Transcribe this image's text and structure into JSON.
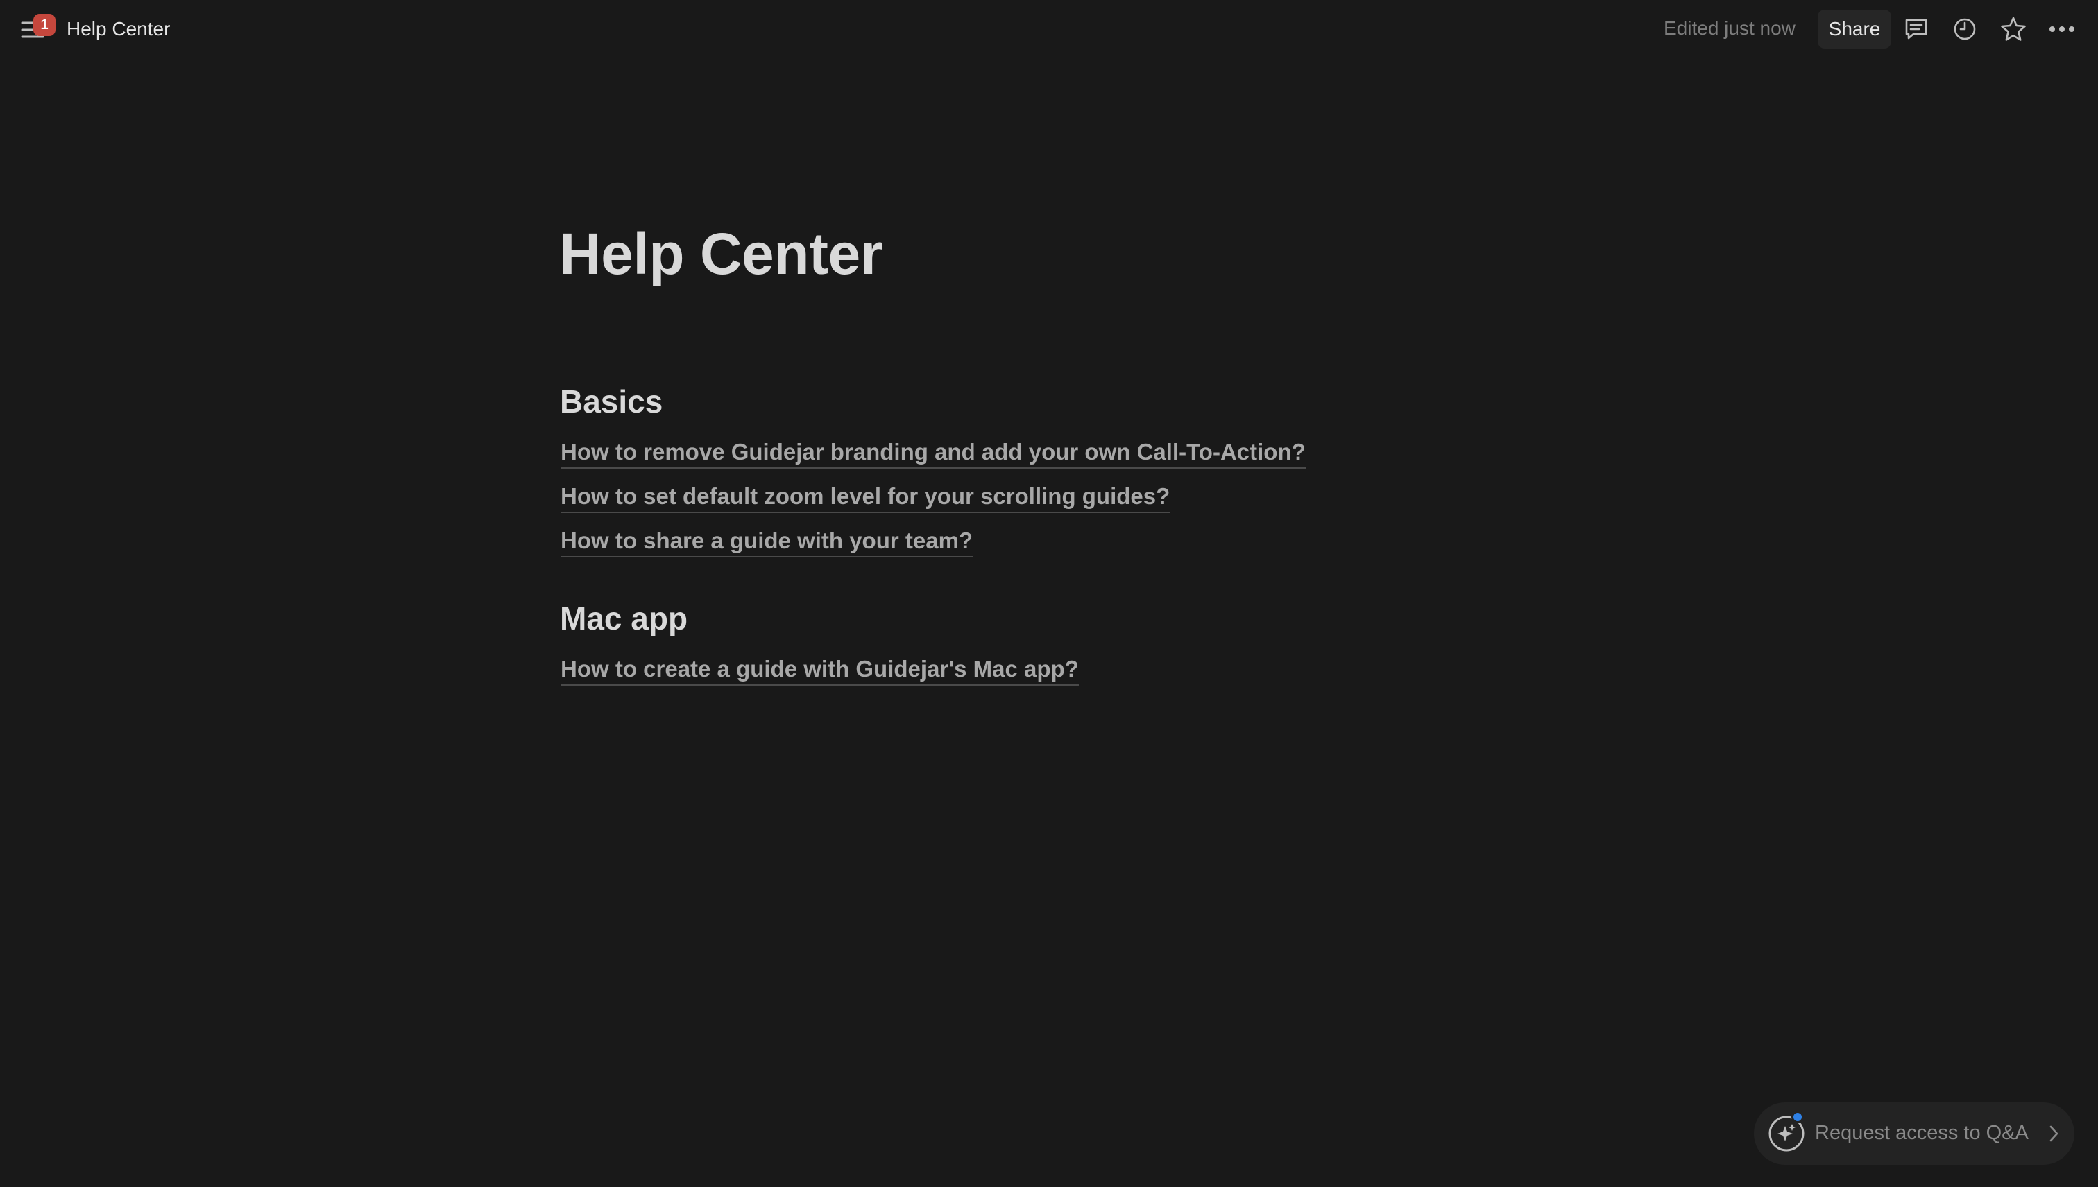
{
  "topbar": {
    "notification_count": "1",
    "title": "Help Center",
    "edited": "Edited just now",
    "share_label": "Share"
  },
  "page": {
    "title": "Help Center",
    "sections": [
      {
        "heading": "Basics",
        "links": [
          "How to remove Guidejar branding and add your own Call-To-Action?",
          "How to set default zoom level for your scrolling guides?",
          "How to share a guide with your team?"
        ]
      },
      {
        "heading": "Mac app",
        "links": [
          "How to create a guide with Guidejar's Mac app?"
        ]
      }
    ]
  },
  "qa": {
    "label": "Request access to Q&A"
  },
  "colors": {
    "background": "#191919",
    "badge": "#c5473d",
    "qa_dot": "#2f81e6"
  }
}
